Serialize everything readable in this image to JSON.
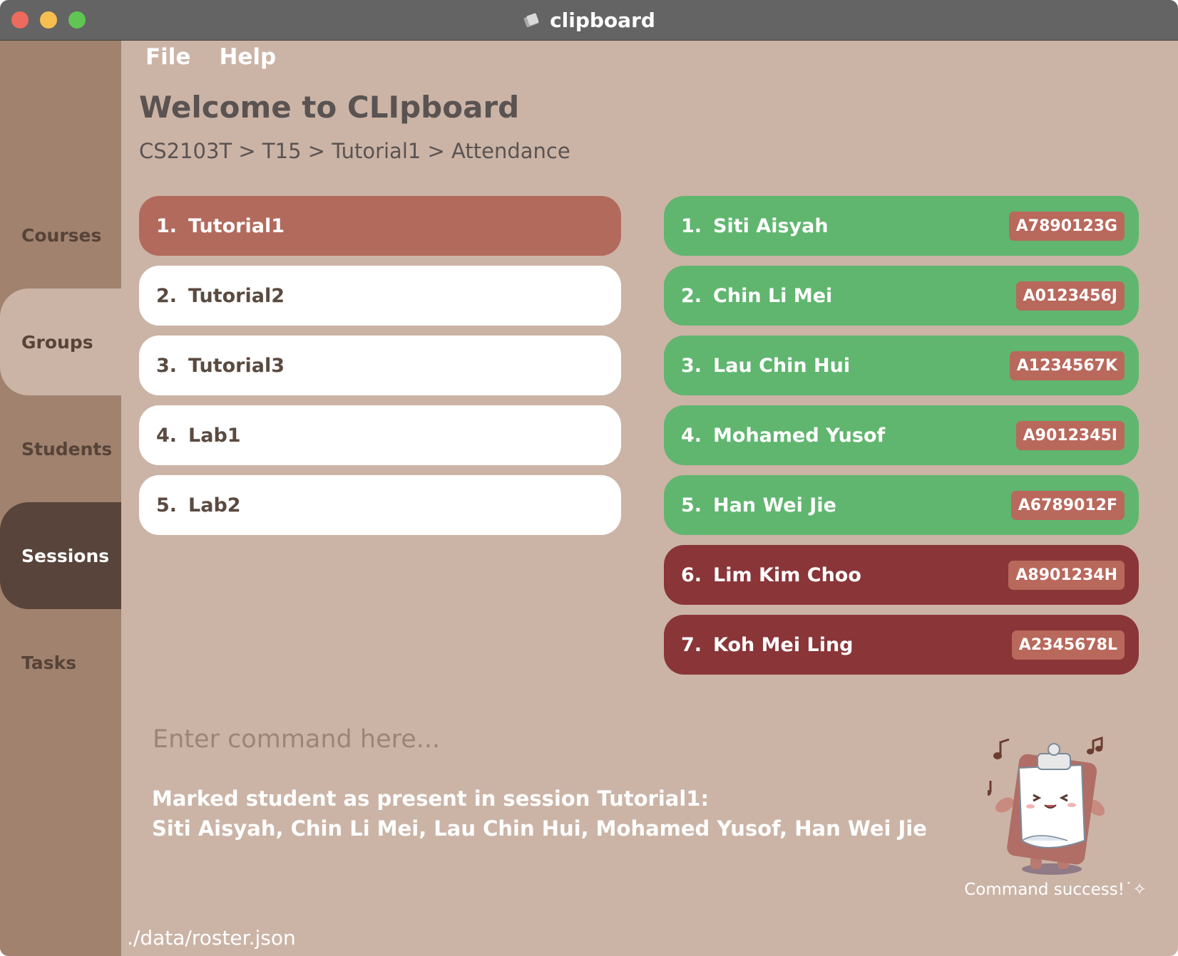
{
  "window": {
    "title": "clipboard"
  },
  "menu": {
    "file": "File",
    "help": "Help"
  },
  "sidebar": {
    "items": [
      {
        "label": "Courses"
      },
      {
        "label": "Groups"
      },
      {
        "label": "Students"
      },
      {
        "label": "Sessions"
      },
      {
        "label": "Tasks"
      }
    ]
  },
  "header": {
    "title": "Welcome to CLIpboard",
    "breadcrumb": "CS2103T > T15 > Tutorial1 > Attendance"
  },
  "sessions": [
    {
      "index": "1.",
      "name": "Tutorial1",
      "selected": true
    },
    {
      "index": "2.",
      "name": "Tutorial2",
      "selected": false
    },
    {
      "index": "3.",
      "name": "Tutorial3",
      "selected": false
    },
    {
      "index": "4.",
      "name": "Lab1",
      "selected": false
    },
    {
      "index": "5.",
      "name": "Lab2",
      "selected": false
    }
  ],
  "attendance": [
    {
      "index": "1.",
      "name": "Siti Aisyah",
      "id": "A7890123G",
      "status": "present"
    },
    {
      "index": "2.",
      "name": "Chin Li Mei",
      "id": "A0123456J",
      "status": "present"
    },
    {
      "index": "3.",
      "name": "Lau Chin Hui",
      "id": "A1234567K",
      "status": "present"
    },
    {
      "index": "4.",
      "name": "Mohamed Yusof",
      "id": "A9012345I",
      "status": "present"
    },
    {
      "index": "5.",
      "name": "Han Wei Jie",
      "id": "A6789012F",
      "status": "present"
    },
    {
      "index": "6.",
      "name": "Lim Kim Choo",
      "id": "A8901234H",
      "status": "absent"
    },
    {
      "index": "7.",
      "name": "Koh Mei Ling",
      "id": "A2345678L",
      "status": "absent"
    }
  ],
  "command": {
    "placeholder": "Enter command here...",
    "value": ""
  },
  "result": {
    "line1": "Marked student as present in session Tutorial1:",
    "line2": "Siti Aisyah, Chin Li Mei, Lau Chin Hui, Mohamed Yusof, Han Wei Jie"
  },
  "mascot": {
    "caption": "Command success!˙✧"
  },
  "status_bar": {
    "path": "./data/roster.json"
  },
  "colors": {
    "background": "#cbb4a6",
    "sidebar": "#a0826e",
    "sidebar_active": "#58443a",
    "selected_session": "#b26a5d",
    "present": "#60b66f",
    "absent": "#8a3538",
    "badge": "#b9685c"
  }
}
